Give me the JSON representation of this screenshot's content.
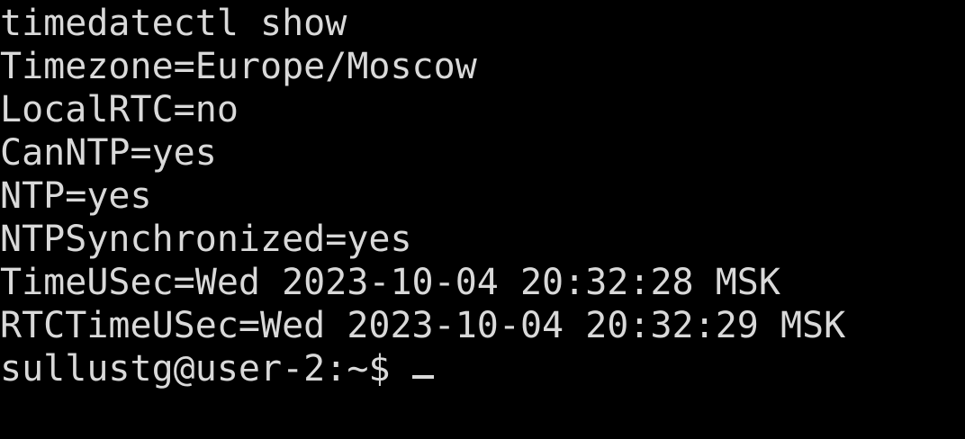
{
  "terminal": {
    "command": "timedatectl show",
    "output": [
      "Timezone=Europe/Moscow",
      "LocalRTC=no",
      "CanNTP=yes",
      "NTP=yes",
      "NTPSynchronized=yes",
      "TimeUSec=Wed 2023-10-04 20:32:28 MSK",
      "RTCTimeUSec=Wed 2023-10-04 20:32:29 MSK"
    ],
    "prompt": "sullustg@user-2:~$ ",
    "colors": {
      "background": "#000000",
      "foreground": "#d9d9d9"
    }
  }
}
